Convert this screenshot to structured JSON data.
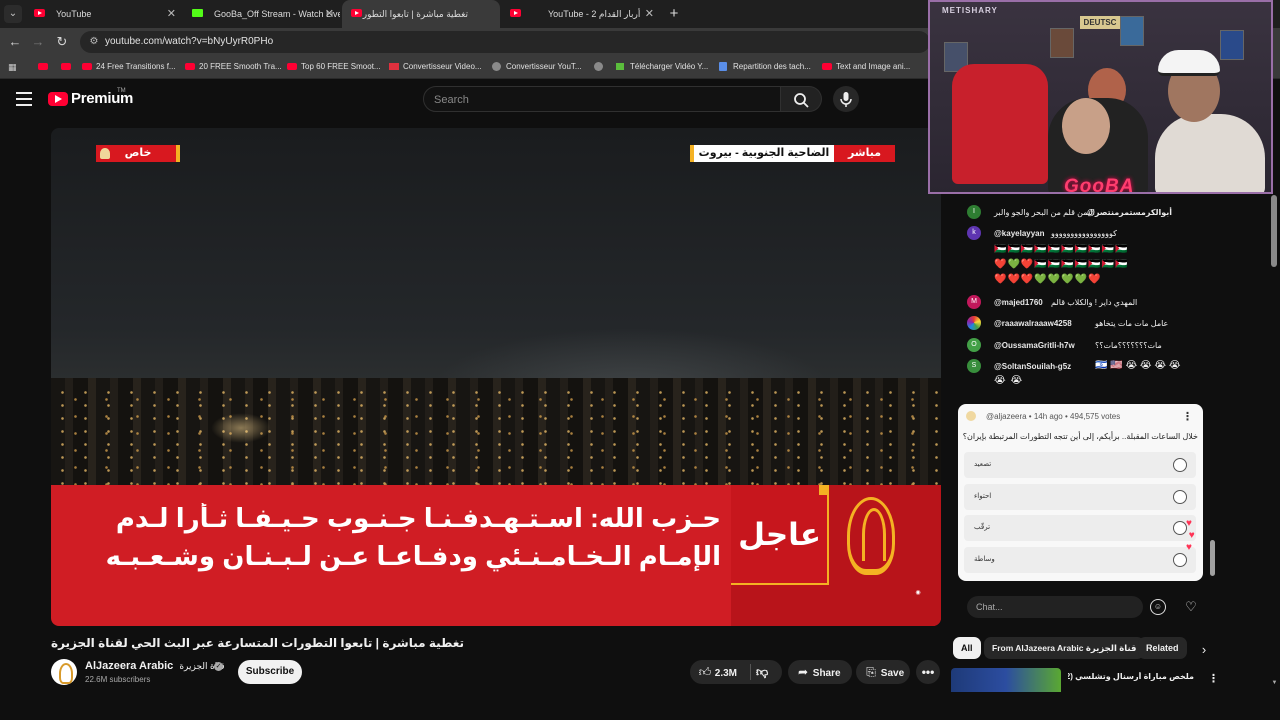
{
  "tabs": [
    {
      "label": "YouTube",
      "icon": "youtube-icon",
      "active": false
    },
    {
      "label": "GooBa_Off Stream - Watch Live",
      "icon": "kick-icon",
      "active": false
    },
    {
      "label": "تغطية مباشرة | تابعوا التطور",
      "icon": "youtube-icon",
      "active": true
    },
    {
      "label": "YouTube - 2 أربار القدام",
      "icon": "youtube-icon",
      "active": false
    }
  ],
  "address": {
    "url": "youtube.com/watch?v=bNyUyrR0PHo"
  },
  "bookmarks": [
    {
      "label": "",
      "icon": "youtube-icon"
    },
    {
      "label": "",
      "icon": "youtube-icon"
    },
    {
      "label": "24 Free Transitions f...",
      "icon": "youtube-icon"
    },
    {
      "label": "20 FREE Smooth Tra...",
      "icon": "youtube-icon"
    },
    {
      "label": "Top 60 FREE Smoot...",
      "icon": "youtube-icon"
    },
    {
      "label": "Convertisseur Video...",
      "icon": "z-icon"
    },
    {
      "label": "Convertisseur YouT...",
      "icon": "converter-icon"
    },
    {
      "label": "",
      "icon": "globe-icon"
    },
    {
      "label": "Télécharger Vidéo Y...",
      "icon": "download-icon"
    },
    {
      "label": "Repartition des tach...",
      "icon": "doc-icon"
    },
    {
      "label": "Text and Image ani...",
      "icon": "youtube-icon"
    }
  ],
  "header": {
    "brand": "Premium",
    "brand_sup": "TM",
    "search_placeholder": "Search"
  },
  "video": {
    "live_tag": "مباشر",
    "location": "الضاحية الجنوبية - بيروت",
    "special_tag": "خاص",
    "breaking": "عاجل",
    "headline_line1": "حـزب الله: اسـتـهـدفـنـا جـنـوب حـيـفـا ثـأرا لـدم",
    "headline_line2": "الإمـام الـخـامـنـئي ودفـاعـا عـن لـبـنـان وشـعـبـه"
  },
  "info": {
    "title": "تغطية مباشرة | تابعوا التطورات المتسارعة عبر البث الحي لقناة الجزيرة",
    "channel": "AlJazeera Arabic",
    "channel_ar": "قناة الجزيرة",
    "subs": "22.6M subscribers",
    "subscribe": "Subscribe",
    "likes": "2.3M",
    "share": "Share",
    "save": "Save"
  },
  "stream": {
    "overlay_name": "GooBA",
    "top_text": "METISHARY",
    "deutsch": "DEUTSC"
  },
  "chat": {
    "messages": [
      {
        "avatar": "I",
        "color": "#2e7d32",
        "user": "@أبوالكرمستمرمنتصر",
        "text": "اليمن قلم من البحر والجو والبر"
      },
      {
        "avatar": "k",
        "color": "#5e35b1",
        "user": "@kayelayyan",
        "text": "كوووووووووووووووو"
      },
      {
        "avatar": "M",
        "color": "#c2185b",
        "user": "@majed1760",
        "text": "المهدي داير ! والكلاب قالم"
      },
      {
        "avatar": "",
        "color": "#1565c0",
        "user": "@raaawalraaaw4258",
        "text": "عامل مات مات يتخاهو"
      },
      {
        "avatar": "O",
        "color": "#43a047",
        "user": "@OussamaGritli-h7w",
        "text": "مات؟؟؟؟؟؟؟مات؟؟"
      },
      {
        "avatar": "S",
        "color": "#388e3c",
        "user": "@SoltanSouilah-g5z",
        "text": "🇮🇱 🇺🇸 😭 😭 😭 😭"
      }
    ],
    "emoji_rows": [
      "🇵🇸🇵🇸🇵🇸🇵🇸🇵🇸🇵🇸🇵🇸🇵🇸🇵🇸🇵🇸",
      "❤️💚❤️🇵🇸🇵🇸🇵🇸🇵🇸🇵🇸🇵🇸🇵🇸",
      "❤️❤️❤️💚💚💚💚❤️"
    ],
    "extra_emoji": "😭 😭",
    "input_placeholder": "Chat..."
  },
  "poll": {
    "meta": "@aljazeera • 14h ago • 494,575 votes",
    "question": "خلال الساعات المقبلة.. برأيكم، إلى أين تتجه التطورات المرتبطة بإيران؟",
    "options": [
      "تصعيد",
      "احتواء",
      "ترقّب",
      "وساطة"
    ]
  },
  "chips": [
    "All",
    "From AlJazeera Arabic قناة الجزيرة",
    "Related"
  ],
  "related": {
    "title": "ملخص مباراة أرسنال وتشلسي (2-1) |"
  }
}
